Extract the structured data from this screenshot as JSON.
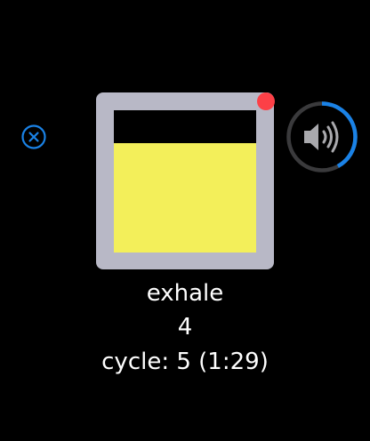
{
  "controls": {
    "close_icon": "circle-x",
    "sound_icon": "speaker-wave",
    "accent_color": "#1a82e6",
    "ring_track_color": "#3a3a3c",
    "speaker_color": "#a9a9ad",
    "sound_progress": 0.42
  },
  "breath": {
    "phase": "exhale",
    "count": "4",
    "cycle": "cycle: 5 (1:29)",
    "fill_level": 0.77,
    "frame_color": "#b8b8c6",
    "fill_color": "#f3ef5a",
    "indicator_color": "#fc4047"
  }
}
